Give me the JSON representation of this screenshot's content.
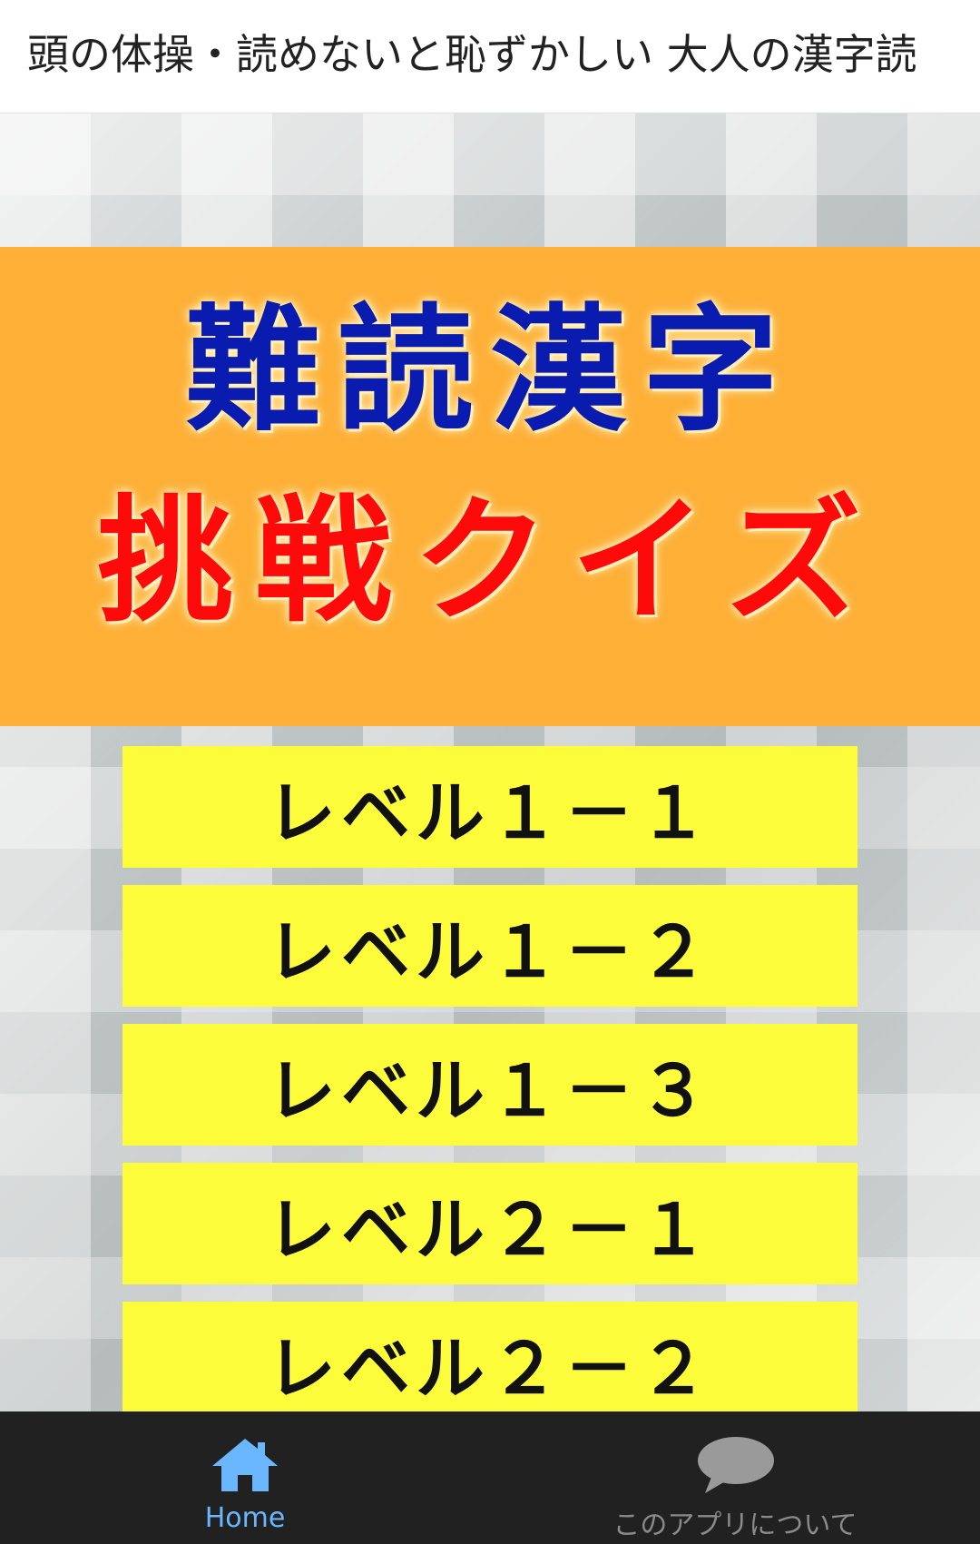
{
  "app_bar": {
    "title": "頭の体操・読めないと恥ずかしい 大人の漢字読"
  },
  "banner": {
    "line1": "難読漢字",
    "line2": "挑戦クイズ",
    "line1_color": "#0a1bb0",
    "line2_color": "#ff0a0a",
    "background_color": "#fdaf36"
  },
  "levels": [
    {
      "label": "レベル１－１"
    },
    {
      "label": "レベル１－２"
    },
    {
      "label": "レベル１－３"
    },
    {
      "label": "レベル２－１"
    },
    {
      "label": "レベル２－２"
    }
  ],
  "bottom_nav": {
    "items": [
      {
        "label": "Home",
        "icon": "home-icon",
        "active": true,
        "color": "#6ab6ff"
      },
      {
        "label": "このアプリについて",
        "icon": "speech-bubble-icon",
        "active": false,
        "color": "#8a8a8a"
      }
    ]
  }
}
